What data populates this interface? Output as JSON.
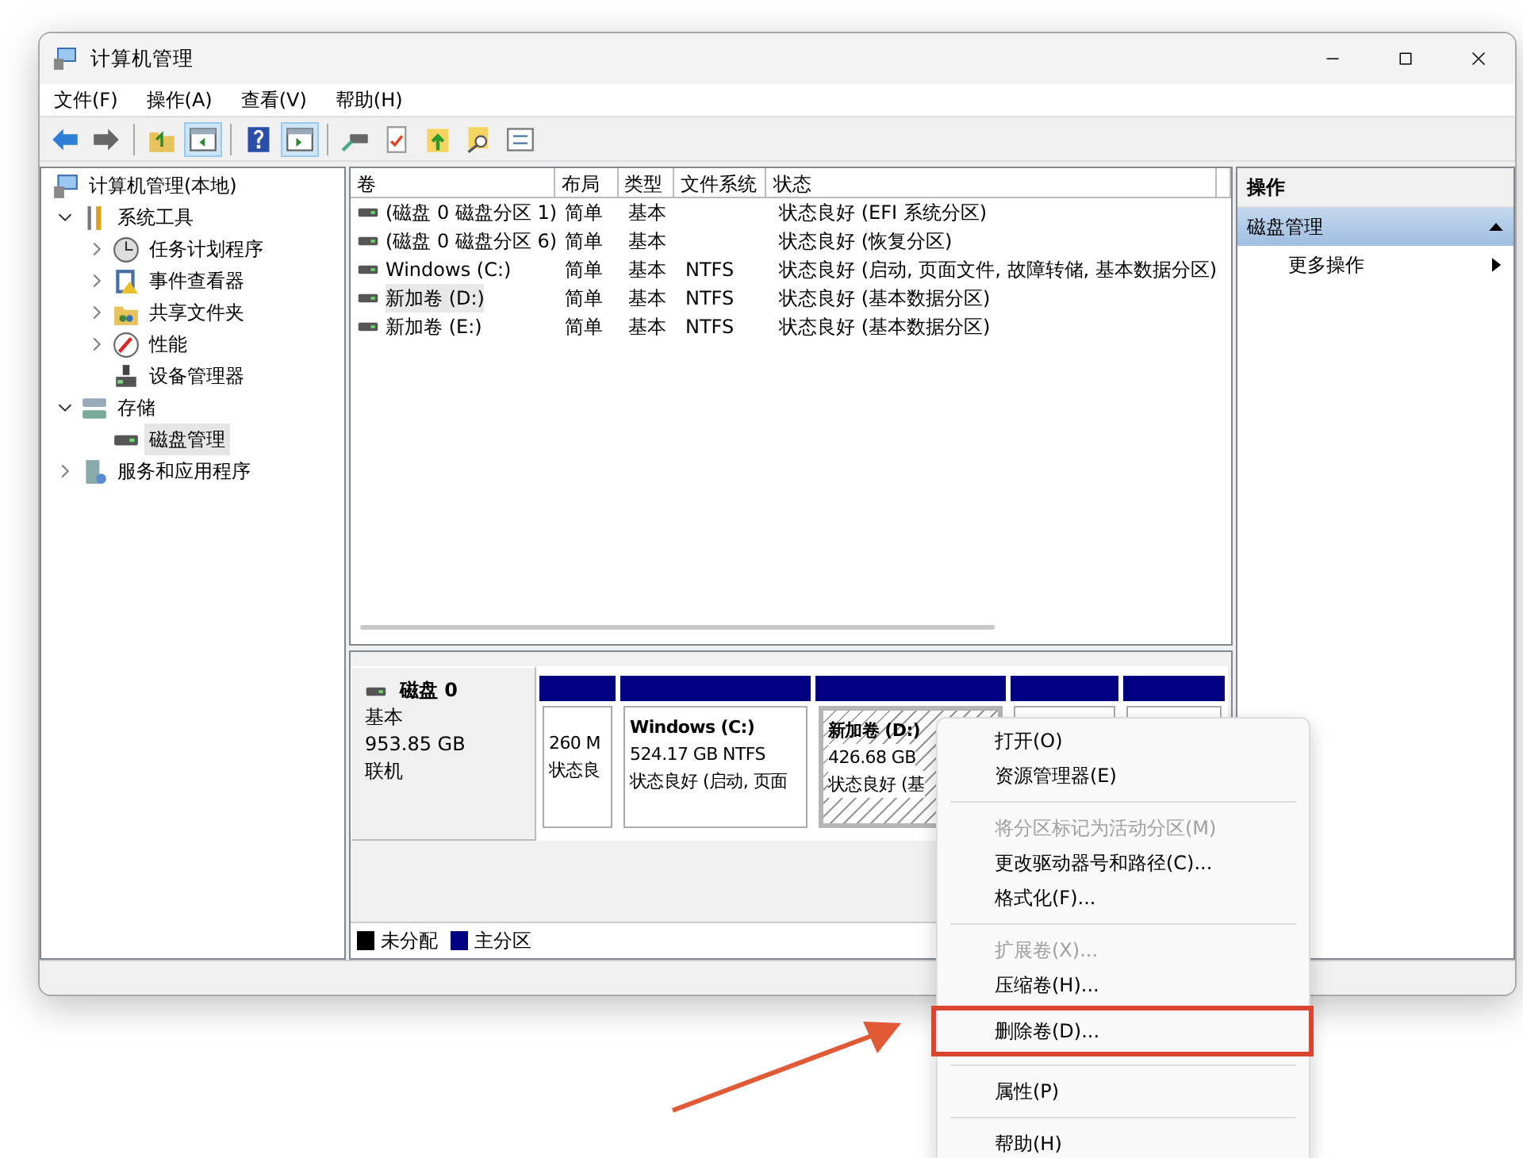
{
  "window": {
    "title": "计算机管理"
  },
  "menu_bar": [
    "文件(F)",
    "操作(A)",
    "查看(V)",
    "帮助(H)"
  ],
  "toolbar": [
    [
      {
        "on": false
      },
      {
        "on": false
      }
    ],
    [
      {
        "on": false
      },
      {
        "on": true
      }
    ],
    [
      {
        "on": false
      },
      {
        "on": true
      }
    ],
    [
      {
        "on": false
      },
      {
        "on": false
      },
      {
        "on": false
      },
      {
        "on": false
      },
      {
        "on": false
      }
    ]
  ],
  "tree": [
    {
      "label": "计算机管理(本地)",
      "selected": false,
      "children": [
        {
          "label": "系统工具",
          "selected": false,
          "expanded": true,
          "children": [
            {
              "label": "任务计划程序",
              "selected": false,
              "expanded": false
            },
            {
              "label": "事件查看器",
              "selected": false,
              "expanded": false
            },
            {
              "label": "共享文件夹",
              "selected": false,
              "expanded": false
            },
            {
              "label": "性能",
              "selected": false,
              "expanded": false
            },
            {
              "label": "设备管理器",
              "selected": false
            }
          ]
        },
        {
          "label": "存储",
          "selected": false,
          "expanded": true,
          "children": [
            {
              "label": "磁盘管理",
              "selected": true
            }
          ]
        },
        {
          "label": "服务和应用程序",
          "selected": false,
          "expanded": false
        }
      ]
    }
  ],
  "volume_table": {
    "columns": [
      "卷",
      "布局",
      "类型",
      "文件系统",
      "状态"
    ],
    "rows": [
      {
        "selected": false,
        "cells": [
          "(磁盘 0 磁盘分区 1)",
          "简单",
          "基本",
          "",
          "状态良好 (EFI 系统分区)"
        ]
      },
      {
        "selected": false,
        "cells": [
          "(磁盘 0 磁盘分区 6)",
          "简单",
          "基本",
          "",
          "状态良好 (恢复分区)"
        ]
      },
      {
        "selected": false,
        "cells": [
          "Windows (C:)",
          "简单",
          "基本",
          "NTFS",
          "状态良好 (启动, 页面文件, 故障转储, 基本数据分区)"
        ]
      },
      {
        "selected": true,
        "cells": [
          "新加卷 (D:)",
          "简单",
          "基本",
          "NTFS",
          "状态良好 (基本数据分区)"
        ]
      },
      {
        "selected": false,
        "cells": [
          "新加卷 (E:)",
          "简单",
          "基本",
          "NTFS",
          "状态良好 (基本数据分区)"
        ]
      }
    ]
  },
  "disk": {
    "name": "磁盘 0",
    "type": "基本",
    "size": "953.85 GB",
    "status": "联机",
    "partitions": [
      {
        "selected": false,
        "lines": [
          "260 M",
          "状态良"
        ]
      },
      {
        "selected": false,
        "title": "Windows  (C:)",
        "lines": [
          "524.17 GB NTFS",
          "状态良好 (启动, 页面"
        ]
      },
      {
        "selected": true,
        "title": "新加卷  (D:)",
        "lines": [
          "426.68 GB",
          "状态良好 (基"
        ]
      },
      {
        "selected": false
      },
      {
        "selected": false
      }
    ]
  },
  "legend": [
    {
      "label": "未分配",
      "color": "#000000"
    },
    {
      "label": "主分区",
      "color": "#000080"
    }
  ],
  "actions": {
    "title": "操作",
    "section": {
      "label": "磁盘管理",
      "expanded": true
    },
    "items": [
      "更多操作"
    ]
  },
  "context_menu": [
    {
      "kind": "item",
      "label": "打开(O)",
      "disabled": false
    },
    {
      "kind": "item",
      "label": "资源管理器(E)",
      "disabled": false
    },
    {
      "kind": "separator"
    },
    {
      "kind": "item",
      "label": "将分区标记为活动分区(M)",
      "disabled": true
    },
    {
      "kind": "item",
      "label": "更改驱动器号和路径(C)...",
      "disabled": false
    },
    {
      "kind": "item",
      "label": "格式化(F)...",
      "disabled": false
    },
    {
      "kind": "separator"
    },
    {
      "kind": "item",
      "label": "扩展卷(X)...",
      "disabled": true
    },
    {
      "kind": "item",
      "label": "压缩卷(H)...",
      "disabled": false
    },
    {
      "kind": "item",
      "label": "删除卷(D)...",
      "disabled": false,
      "highlighted": true
    },
    {
      "kind": "separator"
    },
    {
      "kind": "item",
      "label": "属性(P)",
      "disabled": false
    },
    {
      "kind": "separator"
    },
    {
      "kind": "item",
      "label": "帮助(H)",
      "disabled": false
    }
  ]
}
